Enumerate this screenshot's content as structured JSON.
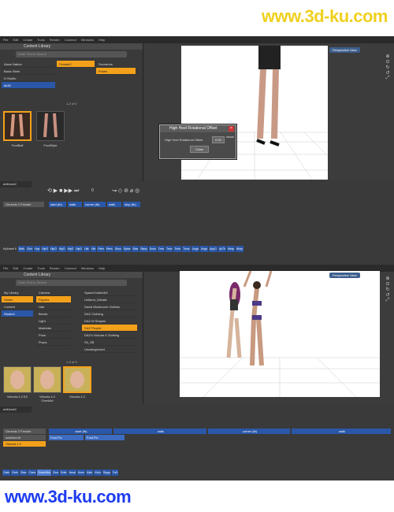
{
  "watermark": {
    "top": "www.3d-ku.com",
    "bottom": "www.3d-ku.com"
  },
  "shot1": {
    "menu": [
      "File",
      "Edit",
      "Create",
      "Tools",
      "Render",
      "Connect",
      "Windows",
      "Help"
    ],
    "library_title": "Content Library",
    "search_placeholder": "Enter Text to Search",
    "col1": [
      "Aiace Nation",
      "Basic Steel",
      "D.Studio",
      "dk30"
    ],
    "col2": [
      "Female2",
      "Poses"
    ],
    "col3": [
      "Scenarios",
      "Poses"
    ],
    "pager": "1-2 of 2",
    "thumbs": [
      "FootBall",
      "FootStyle"
    ],
    "viewport_label": "Perspective View",
    "dialog": {
      "title": "High Heel Rotational Offset",
      "field": "High Heel Rotational Offset",
      "value": "0.00",
      "close_label": "Close"
    },
    "tab": "aniblock2",
    "figure": "Genesis 2 Female",
    "blocks": [
      "start (fb)",
      "walk",
      "corner (fb)",
      "walk",
      "stop (fb)"
    ],
    "frame": "0",
    "anibar_label": "MyAniset 6",
    "anibar": [
      "Bwlk",
      "Chkr",
      "Hop",
      "HipO",
      "HipO",
      "HipO",
      "HipO",
      "HipO",
      "Littr",
      "Littr",
      "Pelvr",
      "Revs",
      "Shou",
      "Spina",
      "Stas",
      "Stasy",
      "Suna",
      "Trew",
      "Trew",
      "Turts",
      "Turns",
      "Unga",
      "Unga",
      "UppO",
      "UpTh",
      "Wrap",
      "Wrap"
    ]
  },
  "shot2": {
    "menu": [
      "File",
      "Edit",
      "Create",
      "Tools",
      "Render",
      "Connect",
      "Windows",
      "Help"
    ],
    "library_title": "Content Library",
    "search_placeholder": "Enter Text to Search",
    "col1": [
      "My Library",
      "Studio",
      "Content",
      "Studio3"
    ],
    "col2": [
      "Camera",
      "Figures",
      "Hair",
      "Bends",
      "Light",
      "Materials",
      "Pose",
      "Props"
    ],
    "col3": [
      "Space/Cabin/4/6",
      "Uniform_Details",
      "David Mushroom Clothes",
      "DAZ Clothing",
      "DAZ M Shapes",
      "DAZ People",
      "DAZ's Victoria 4 Clothing",
      "Sh_SB",
      "Uncategorized"
    ],
    "pager": "1-3 of 3",
    "thumbs": [
      "Victoria 4.2 EZ",
      "Victoria 4.2 OverlAct",
      "Victoria 4.2"
    ],
    "viewport_label": "Perspective View",
    "tab": "aniblock2",
    "figures": [
      "Genesis 2 Female",
      "switchcroft",
      "Victoria 4.2"
    ],
    "blocks": [
      "start (fb)",
      "walk",
      "corner (fb)",
      "walk"
    ],
    "sub_blocks": [
      "Foot Fix",
      "Foot Fix"
    ],
    "anibar": [
      "Clath",
      "Chek",
      "Clew",
      "Chew",
      "ChewKlick",
      "Clea",
      "Exler",
      "Head",
      "Kerm",
      "Klckr",
      "Klckr",
      "Rtpgs",
      "Tor9"
    ]
  }
}
